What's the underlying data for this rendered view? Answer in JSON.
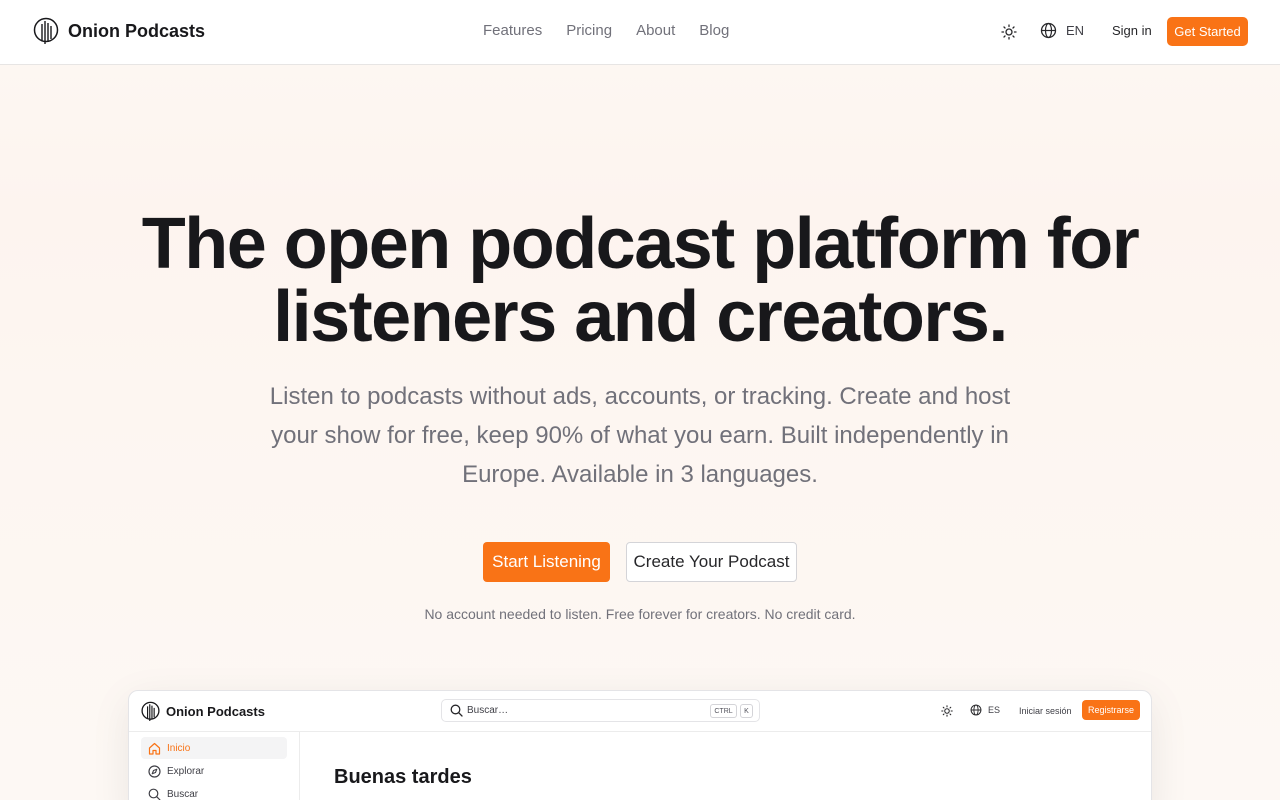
{
  "header": {
    "brand": "Onion Podcasts",
    "nav": [
      "Features",
      "Pricing",
      "About",
      "Blog"
    ],
    "theme_icon": "sun-icon",
    "language_icon": "globe-icon",
    "language": "EN",
    "sign_in": "Sign in",
    "get_started": "Get Started"
  },
  "hero": {
    "title_line1": "The open podcast platform for",
    "title_line2": "listeners and creators.",
    "subtitle": "Listen to podcasts without ads, accounts, or tracking. Create and host your show for free, keep 90% of what you earn. Built independently in Europe. Available in 3 languages.",
    "primary_cta": "Start Listening",
    "secondary_cta": "Create Your Podcast",
    "note": "No account needed to listen. Free forever for creators. No credit card."
  },
  "preview": {
    "brand": "Onion Podcasts",
    "search_placeholder": "Buscar…",
    "shortcut_keys": [
      "CTRL",
      "K"
    ],
    "language": "ES",
    "sign_in": "Iniciar sesión",
    "register": "Registrarse",
    "sidebar": [
      {
        "label": "Inicio",
        "icon": "home-icon",
        "active": true
      },
      {
        "label": "Explorar",
        "icon": "compass-icon",
        "active": false
      },
      {
        "label": "Buscar",
        "icon": "search-icon",
        "active": false
      }
    ],
    "greeting": "Buenas tardes"
  },
  "colors": {
    "accent": "#f97316",
    "text": "#18181b",
    "muted": "#71717a"
  }
}
